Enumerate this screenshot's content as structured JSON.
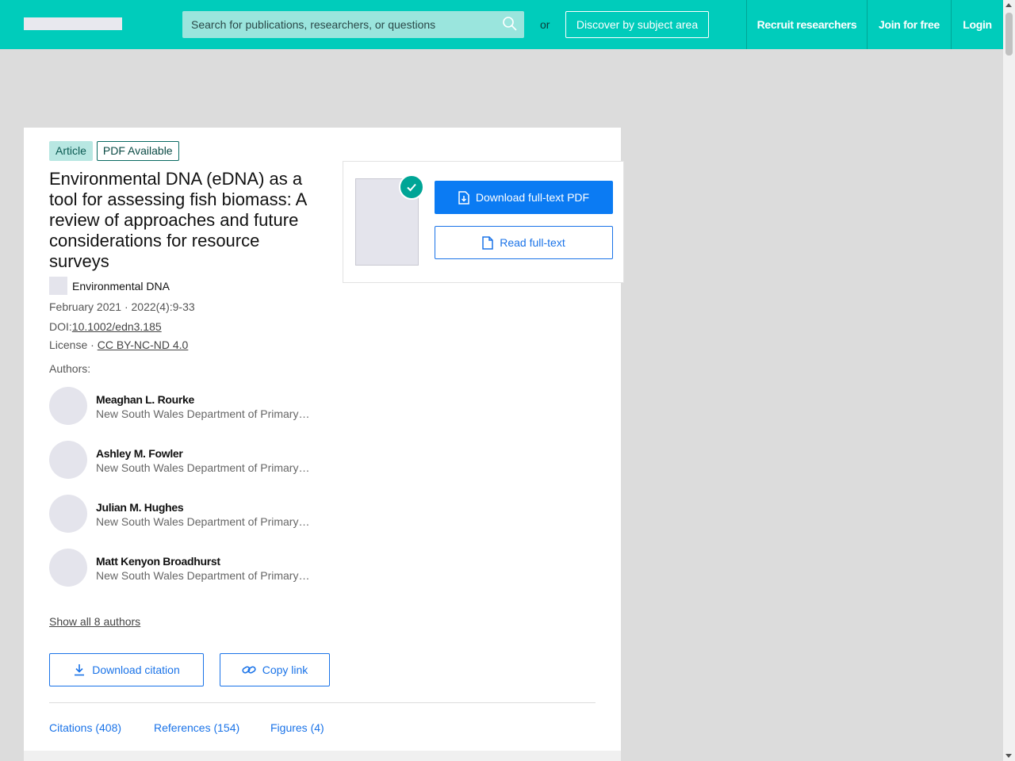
{
  "header": {
    "search_placeholder": "Search for publications, researchers, or questions",
    "or_text": "or",
    "discover_label": "Discover by subject area",
    "nav": {
      "recruit": "Recruit researchers",
      "join": "Join for free",
      "login": "Login"
    }
  },
  "article": {
    "badges": {
      "type": "Article",
      "pdf": "PDF Available"
    },
    "title": "Environmental DNA (eDNA) as a tool for assessing fish biomass: A review of approaches and future considerations for resource surveys",
    "journal": "Environmental DNA",
    "date_issue": "February 2021 · 2022(4):9-33",
    "doi_label": "DOI:",
    "doi": "10.1002/edn3.185",
    "license_label": "License · ",
    "license": "CC BY-NC-ND 4.0",
    "authors_label": "Authors:",
    "authors": [
      {
        "name": "Meaghan L. Rourke",
        "affiliation": "New South Wales Department of Primary Industries"
      },
      {
        "name": "Ashley M. Fowler",
        "affiliation": "New South Wales Department of Primary Industries"
      },
      {
        "name": "Julian M. Hughes",
        "affiliation": "New South Wales Department of Primary Industries"
      },
      {
        "name": "Matt Kenyon Broadhurst",
        "affiliation": "New South Wales Department of Primary Industries"
      }
    ],
    "show_all": "Show all 8 authors",
    "download_citation": "Download citation",
    "copy_link": "Copy link",
    "tabs": {
      "citations": "Citations (408)",
      "references": "References (154)",
      "figures": "Figures (4)"
    }
  },
  "pdf_box": {
    "download_pdf": "Download full-text PDF",
    "read_fulltext": "Read full-text"
  },
  "colors": {
    "brand_teal": "#00ccbb",
    "primary_blue": "#0b7bf3",
    "link_blue": "#1a73e8"
  }
}
